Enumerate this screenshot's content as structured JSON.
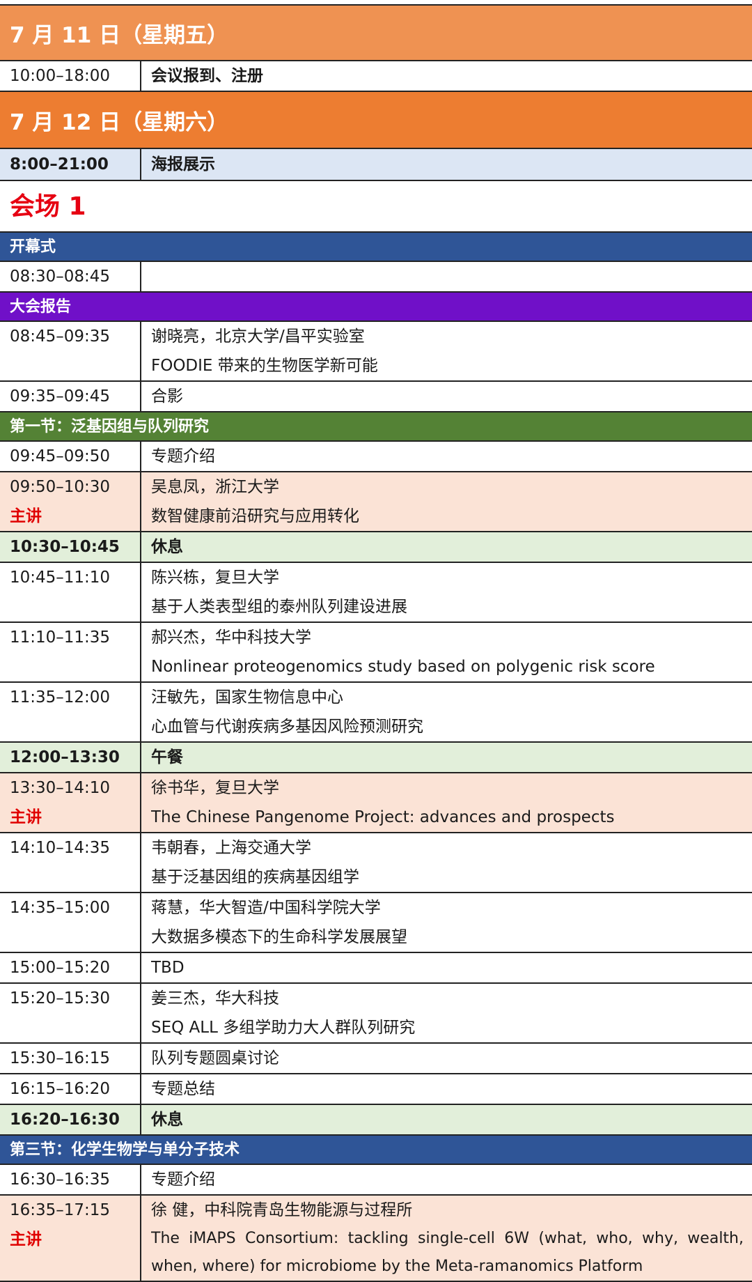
{
  "day1": {
    "header": "7 月 11 日（星期五）",
    "row": {
      "time": "10:00–18:00",
      "title": "会议报到、注册"
    }
  },
  "day2": {
    "header": "7 月 12 日（星期六）",
    "poster": {
      "time": "8:00–21:00",
      "title": "海报展示"
    }
  },
  "venue": "会场 1",
  "opening": {
    "label": "开幕式",
    "time": "08:30–08:45"
  },
  "plenary": {
    "label": "大会报告",
    "rows": [
      {
        "time": "08:45–09:35",
        "speaker": "谢晓亮，北京大学/昌平实验室",
        "topic": "FOODIE 带来的生物医学新可能"
      },
      {
        "time": "09:35–09:45",
        "speaker": "合影"
      }
    ]
  },
  "section1": {
    "label": "第一节：泛基因组与队列研究",
    "rows": [
      {
        "time": "09:45–09:50",
        "speaker": "专题介绍"
      },
      {
        "time": "09:50–10:30",
        "tag": "主讲",
        "speaker": "吴息凤，浙江大学",
        "topic": "数智健康前沿研究与应用转化",
        "style": "keynote"
      },
      {
        "time": "10:30–10:45",
        "speaker": "休息",
        "style": "break"
      },
      {
        "time": "10:45–11:10",
        "speaker": "陈兴栋，复旦大学",
        "topic": "基于人类表型组的泰州队列建设进展"
      },
      {
        "time": "11:10–11:35",
        "speaker": "郝兴杰，华中科技大学",
        "topic": "Nonlinear proteogenomics study based on polygenic risk score"
      },
      {
        "time": "11:35–12:00",
        "speaker": "汪敏先，国家生物信息中心",
        "topic": "心血管与代谢疾病多基因风险预测研究"
      },
      {
        "time": "12:00–13:30",
        "speaker": "午餐",
        "style": "break"
      },
      {
        "time": "13:30–14:10",
        "tag": "主讲",
        "speaker": "徐书华，复旦大学",
        "topic": "The Chinese Pangenome Project: advances and prospects",
        "style": "keynote"
      },
      {
        "time": "14:10–14:35",
        "speaker": "韦朝春，上海交通大学",
        "topic": "基于泛基因组的疾病基因组学"
      },
      {
        "time": "14:35–15:00",
        "speaker": "蒋慧，华大智造/中国科学院大学",
        "topic": "大数据多模态下的生命科学发展展望"
      },
      {
        "time": "15:00–15:20",
        "speaker": "TBD"
      },
      {
        "time": "15:20–15:30",
        "speaker": "姜三杰，华大科技",
        "topic": "SEQ ALL 多组学助力大人群队列研究"
      },
      {
        "time": "15:30–16:15",
        "speaker": "队列专题圆桌讨论"
      },
      {
        "time": "16:15–16:20",
        "speaker": "专题总结"
      },
      {
        "time": "16:20–16:30",
        "speaker": "休息",
        "style": "break"
      }
    ]
  },
  "section3": {
    "label": "第三节：化学生物学与单分子技术",
    "rows": [
      {
        "time": "16:30–16:35",
        "speaker": "专题介绍"
      },
      {
        "time": "16:35–17:15",
        "tag": "主讲",
        "speaker": "徐 健，中科院青岛生物能源与过程所",
        "topic": "The iMAPS Consortium: tackling single-cell 6W (what, who, why, wealth, when, where) for microbiome by the Meta-ramanomics Platform",
        "style": "keynote"
      }
    ]
  },
  "colors": {
    "day1_band": "#EF9252",
    "day2_band": "#ED7D31",
    "section_blue": "#2F5597",
    "section_purple": "#7010C8",
    "section_green": "#548235",
    "keynote_bg": "#FBE3D6",
    "break_bg": "#E2EFDA",
    "poster_bg": "#DCE6F4",
    "accent_red": "#E60012"
  }
}
